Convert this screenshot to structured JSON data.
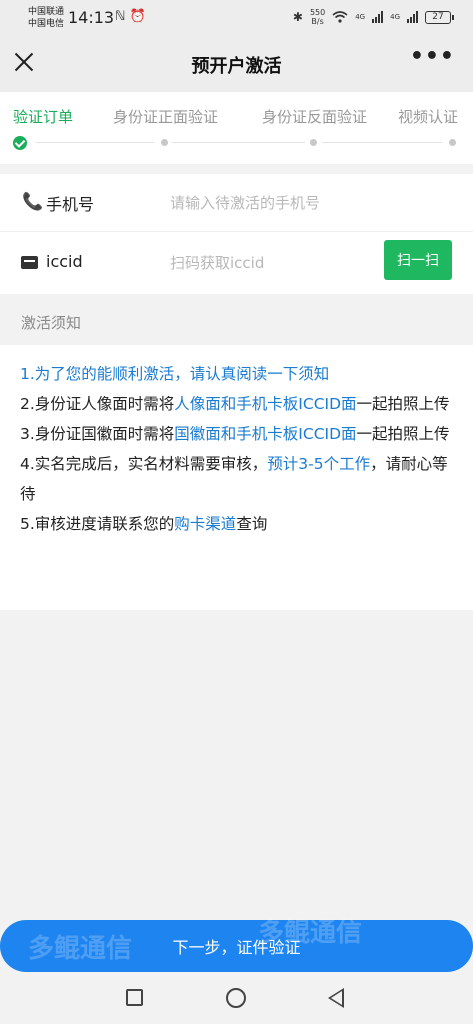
{
  "status_bar": {
    "carrier_1": "中国联通",
    "carrier_2": "中国电信",
    "time": "14:13",
    "left_icons": "ℕ ⏰",
    "speed_value": "550",
    "speed_unit": "B/s",
    "wifi_icon": "wifi-icon",
    "network_1": "4G",
    "network_2": "4G",
    "battery": "27"
  },
  "header": {
    "title": "预开户激活",
    "close_icon": "close-icon",
    "more_label": "•••"
  },
  "steps": {
    "items": [
      {
        "label": "验证订单",
        "state": "done"
      },
      {
        "label": "身份证正面验证",
        "state": "pending"
      },
      {
        "label": "身份证反面验证",
        "state": "pending"
      },
      {
        "label": "视频认证",
        "state": "pending"
      }
    ],
    "active_color": "#1aad5a"
  },
  "form": {
    "phone_icon": "📞",
    "phone_label": "手机号",
    "phone_placeholder": "请输入待激活的手机号",
    "phone_value": "",
    "iccid_label": "iccid",
    "iccid_placeholder": "扫码获取iccid",
    "iccid_value": "",
    "scan_label": "扫一扫"
  },
  "notice": {
    "title": "激活须知",
    "line1": "1.为了您的能顺利激活，请认真阅读一下须知",
    "line2_a": "2.身份证人像面时需将",
    "line2_hl": "人像面和手机卡板ICCID面",
    "line2_b": "一起拍照上传",
    "line3_a": "3.身份证国徽面时需将",
    "line3_hl": "国徽面和手机卡板ICCID面",
    "line3_b": "一起拍照上传",
    "line4_a": "4.实名完成后，实名材料需要审核，",
    "line4_hl": "预计3-5个工作",
    "line4_b": "，请耐心等待",
    "line5_a": "5.审核进度请联系您的",
    "line5_hl": "购卡渠道",
    "line5_b": "查询",
    "highlight_color": "#1a7bd1"
  },
  "footer": {
    "next_label": "下一步，证件验证",
    "watermark": "多鲲通信",
    "button_color": "#1d84f0"
  }
}
